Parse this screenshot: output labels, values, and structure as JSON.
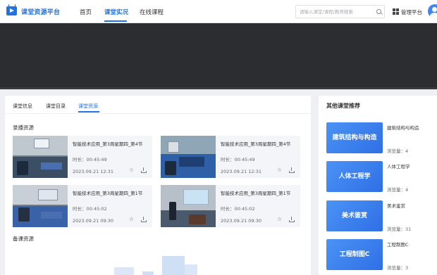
{
  "header": {
    "logo_text": "课堂资源平台",
    "nav": [
      "首页",
      "课堂实况",
      "在线课程"
    ],
    "search_placeholder": "请输入课堂/课程/教师搜索",
    "mgmt_label": "管理平台"
  },
  "tabs": [
    "课堂信息",
    "课堂目录",
    "课堂资源"
  ],
  "recording": {
    "title": "录播资源",
    "cards": [
      {
        "title": "智能技术应用_第3周星期四_第4节",
        "duration": "时长：00:45:49",
        "date": "2023.09.21 12:31"
      },
      {
        "title": "智能技术应用_第3周星期四_第4节",
        "duration": "时长：00:45:49",
        "date": "2023.09.21 12:31"
      },
      {
        "title": "智能技术应用_第3周星期四_第1节",
        "duration": "时长：00:45:02",
        "date": "2023.09.21 09:30"
      },
      {
        "title": "智能技术应用_第3周星期四_第1节",
        "duration": "时长：00:45:02",
        "date": "2023.09.21 09:30"
      }
    ]
  },
  "prep": {
    "title": "备课资源"
  },
  "side": {
    "title": "其他课堂推荐",
    "items": [
      {
        "banner": "建筑结构与构造",
        "name": "建筑结构与构造",
        "views": "浏览量：4"
      },
      {
        "banner": "人体工程学",
        "name": "人体工程学",
        "views": "浏览量：4"
      },
      {
        "banner": "美术鉴赏",
        "name": "美术鉴赏",
        "views": "浏览量：31"
      },
      {
        "banner": "工程制图C",
        "name": "工程制图C",
        "views": "浏览量：3"
      }
    ]
  },
  "colors": {
    "accent": "#1e73e8",
    "player_bg": "#2b2d31",
    "page_bg": "#eef0f3"
  },
  "icons": [
    "logo-play-icon",
    "search-icon",
    "grid-icon",
    "user-avatar",
    "star-icon",
    "download-icon"
  ]
}
